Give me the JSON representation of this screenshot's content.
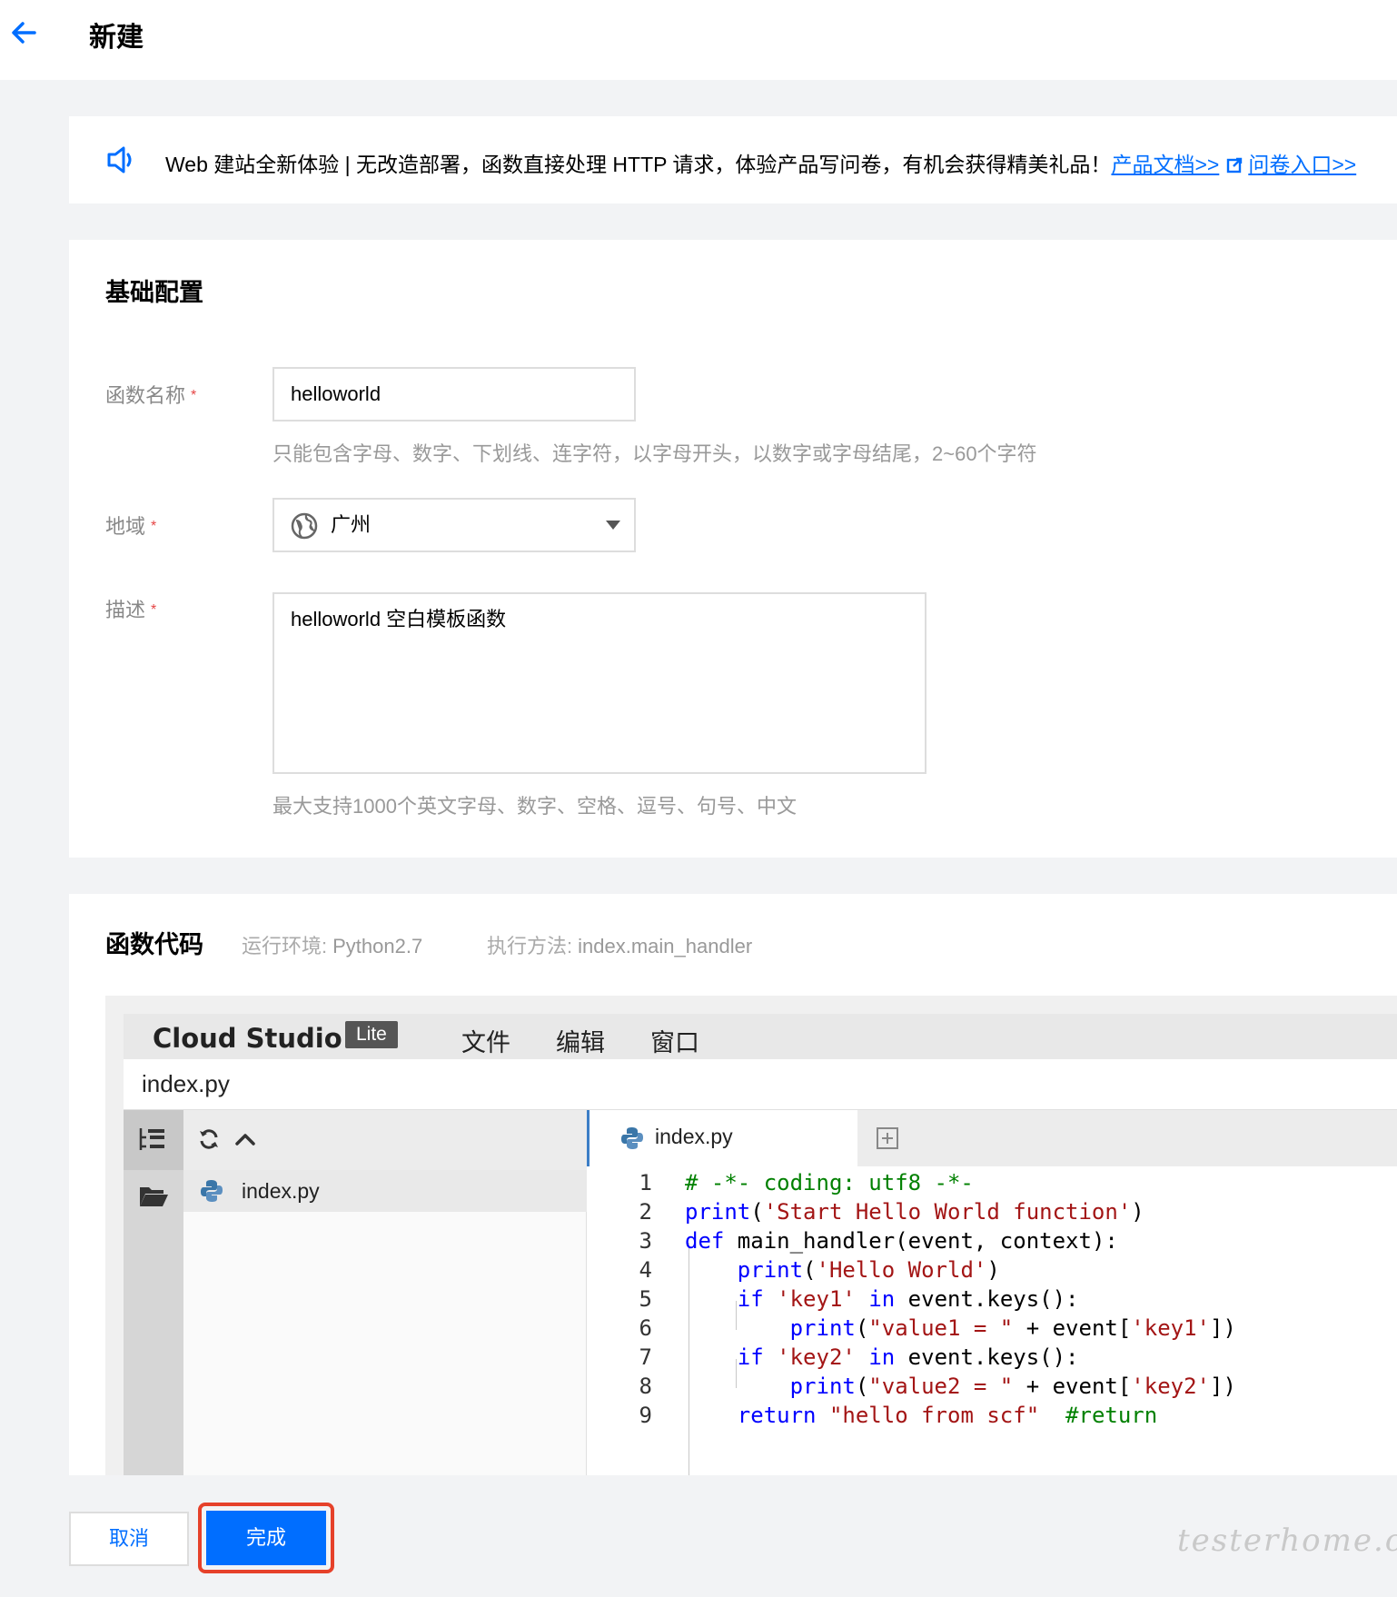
{
  "header": {
    "title": "新建"
  },
  "notice": {
    "text": "Web 建站全新体验 | 无改造部署，函数直接处理 HTTP 请求，体验产品写问卷，有机会获得精美礼品！",
    "doc_link": "产品文档>>",
    "survey_link": "问卷入口>>"
  },
  "basic": {
    "title": "基础配置",
    "name_label": "函数名称",
    "name_value": "helloworld",
    "name_hint": "只能包含字母、数字、下划线、连字符，以字母开头，以数字或字母结尾，2~60个字符",
    "region_label": "地域",
    "region_value": "广州",
    "desc_label": "描述",
    "desc_value": "helloworld 空白模板函数",
    "desc_hint": "最大支持1000个英文字母、数字、空格、逗号、句号、中文",
    "required_mark": "*"
  },
  "code": {
    "title": "函数代码",
    "runtime_label": "运行环境:",
    "runtime_value": "Python2.7",
    "handler_label": "执行方法:",
    "handler_value": "index.main_handler"
  },
  "ide": {
    "brand": "Cloud Studio",
    "badge": "Lite",
    "menu": [
      "文件",
      "编辑",
      "窗口"
    ],
    "file_title": "index.py",
    "tree_file": "index.py",
    "tab_label": "index.py",
    "lines": [
      "1",
      "2",
      "3",
      "4",
      "5",
      "6",
      "7",
      "8",
      "9"
    ]
  },
  "actions": {
    "cancel": "取消",
    "done": "完成"
  },
  "watermark": "testerhome.com",
  "colors": {
    "primary": "#006eff",
    "highlight": "#e6412a",
    "keyword": "#0000ff",
    "string": "#a31515",
    "comment": "#008000"
  }
}
